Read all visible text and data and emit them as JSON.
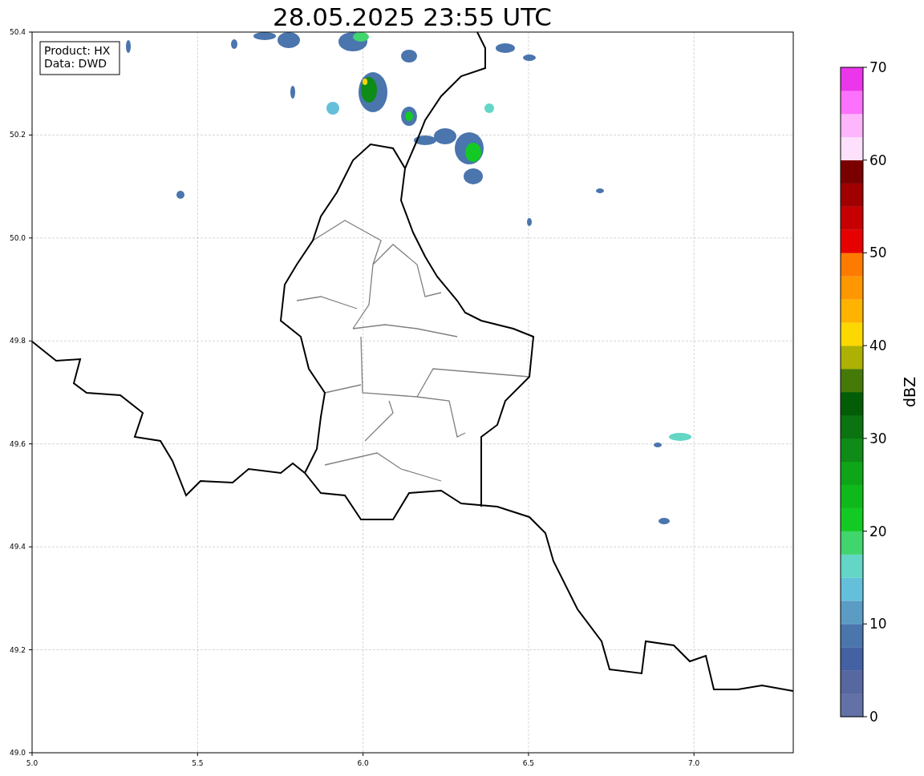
{
  "title": "28.05.2025 23:55 UTC",
  "legend": [
    "Product: HX",
    "Data: DWD"
  ],
  "map": {
    "x_ticks": [
      "5.0",
      "5.5",
      "6.0",
      "6.5",
      "7.0"
    ],
    "y_ticks": [
      "50.4",
      "50.2",
      "50.0",
      "49.8",
      "49.6",
      "49.4",
      "49.2",
      "49.0"
    ]
  },
  "colorbar": {
    "label": "dBZ",
    "ticks": [
      "70",
      "60",
      "50",
      "40",
      "30",
      "20",
      "10",
      "0"
    ],
    "bins": [
      {
        "color": "#6371a6"
      },
      {
        "color": "#57679f"
      },
      {
        "color": "#4361a3"
      },
      {
        "color": "#4a75ad"
      },
      {
        "color": "#5b9cc4"
      },
      {
        "color": "#64c0da"
      },
      {
        "color": "#63d6c6"
      },
      {
        "color": "#40d56d"
      },
      {
        "color": "#13c923"
      },
      {
        "color": "#10b91b"
      },
      {
        "color": "#0fa519"
      },
      {
        "color": "#0e8c17"
      },
      {
        "color": "#0b7310"
      },
      {
        "color": "#035d07"
      },
      {
        "color": "#457a08"
      },
      {
        "color": "#adb103"
      },
      {
        "color": "#fdd700"
      },
      {
        "color": "#fdb300"
      },
      {
        "color": "#ff9700"
      },
      {
        "color": "#ff7b00"
      },
      {
        "color": "#e60000"
      },
      {
        "color": "#c60000"
      },
      {
        "color": "#a10000"
      },
      {
        "color": "#7a0000"
      },
      {
        "color": "#fce0fc"
      },
      {
        "color": "#fdb5fc"
      },
      {
        "color": "#fc72fc"
      },
      {
        "color": "#eb36eb"
      }
    ]
  }
}
